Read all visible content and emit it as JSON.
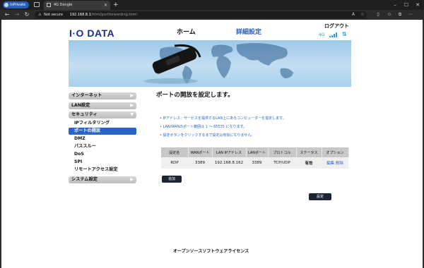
{
  "browser": {
    "profile_label": "InPrivate",
    "tab_title": "4G Dongle",
    "address_warning": "Not secure",
    "address_host": "192.168.8.1",
    "address_path": "/html/portforwarding.html"
  },
  "header": {
    "logo": "I·O DATA",
    "nav_home": "ホーム",
    "nav_advanced": "詳細設定",
    "logout": "ログアウト",
    "network_type": "4G",
    "transfer_icon": "⇅"
  },
  "sidebar": {
    "items": [
      {
        "label": "インターネット"
      },
      {
        "label": "LAN設定"
      },
      {
        "label": "セキュリティ"
      },
      {
        "label": "IPフィルタリング"
      },
      {
        "label": "ポートの開放"
      },
      {
        "label": "DMZ"
      },
      {
        "label": "パススルー"
      },
      {
        "label": "DoS"
      },
      {
        "label": "SPI"
      },
      {
        "label": "リモートアクセス設定"
      },
      {
        "label": "システム設定"
      }
    ]
  },
  "main": {
    "title": "ポートの開放を設定します。",
    "notes": [
      "• IPアドレス：サービスを提供するLAN上にあるコンピューターを指定します。",
      "• LAN/WANのポート範囲は 1 〜 65535 になります。",
      "• 設定ボタンをクリックするまで設定は有効になりません。"
    ],
    "table": {
      "headers": [
        "設定名",
        "WANポート",
        "LAN IPアドレス",
        "LANポート",
        "プロトコル",
        "ステータス",
        "オプション"
      ],
      "rows": [
        {
          "name": "RDP",
          "wan_port": "3389",
          "lan_ip": "192.168.8.162",
          "lan_port": "3389",
          "protocol": "TCP/UDP",
          "status": "有効",
          "edit": "編集",
          "delete": "削除"
        }
      ]
    },
    "add_button": "追加",
    "apply_button": "設定"
  },
  "footer": {
    "oss_license": "オープンソースソフトウェアライセンス"
  },
  "colors": {
    "brand": "#1c2f86",
    "accent": "#2a64c8",
    "button_dark": "#1d2434"
  }
}
